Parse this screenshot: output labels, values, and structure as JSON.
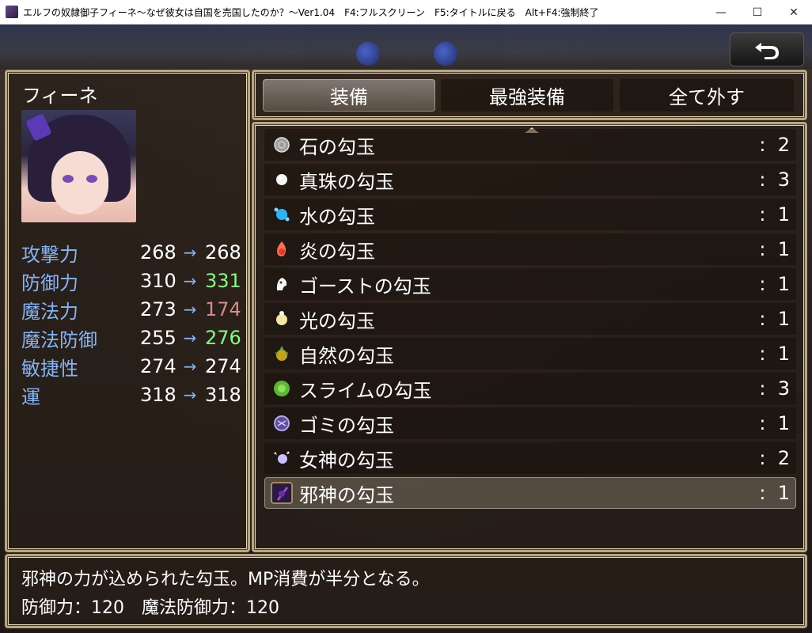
{
  "window": {
    "title": "エルフの奴隷御子フィーネ～なぜ彼女は自国を売国したのか？～Ver1.04　F4:フルスクリーン　F5:タイトルに戻る　Alt+F4:強制終了",
    "minimize": "—",
    "maximize": "☐",
    "close": "✕"
  },
  "back_button": {
    "icon": "return-arrow-icon",
    "glyph": "⮌"
  },
  "status": {
    "name": "フィーネ",
    "stats": [
      {
        "label": "攻撃力",
        "current": "268",
        "arrow": "→",
        "new": "268",
        "change": "same"
      },
      {
        "label": "防御力",
        "current": "310",
        "arrow": "→",
        "new": "331",
        "change": "up"
      },
      {
        "label": "魔法力",
        "current": "273",
        "arrow": "→",
        "new": "174",
        "change": "down"
      },
      {
        "label": "魔法防御",
        "current": "255",
        "arrow": "→",
        "new": "276",
        "change": "up"
      },
      {
        "label": "敏捷性",
        "current": "274",
        "arrow": "→",
        "new": "274",
        "change": "same"
      },
      {
        "label": "運",
        "current": "318",
        "arrow": "→",
        "new": "318",
        "change": "same"
      }
    ]
  },
  "commands": [
    {
      "label": "装備",
      "selected": true
    },
    {
      "label": "最強装備",
      "selected": false
    },
    {
      "label": "全て外す",
      "selected": false
    }
  ],
  "items": [
    {
      "name": "石の勾玉",
      "count": ":  2",
      "icon": "stone-orb-icon",
      "color": "#b9b9b9"
    },
    {
      "name": "真珠の勾玉",
      "count": ":  3",
      "icon": "pearl-icon",
      "color": "#f2f2f2"
    },
    {
      "name": "水の勾玉",
      "count": ":  1",
      "icon": "water-orb-icon",
      "color": "#4fc3f7"
    },
    {
      "name": "炎の勾玉",
      "count": ":  1",
      "icon": "fire-orb-icon",
      "color": "#f4511e"
    },
    {
      "name": "ゴーストの勾玉",
      "count": ":  1",
      "icon": "ghost-orb-icon",
      "color": "#eeeeee"
    },
    {
      "name": "光の勾玉",
      "count": ":  1",
      "icon": "light-orb-icon",
      "color": "#f3e6b0"
    },
    {
      "name": "自然の勾玉",
      "count": ":  1",
      "icon": "nature-orb-icon",
      "color": "#c6a012"
    },
    {
      "name": "スライムの勾玉",
      "count": ":  3",
      "icon": "slime-orb-icon",
      "color": "#6fcf3c"
    },
    {
      "name": "ゴミの勾玉",
      "count": ":  1",
      "icon": "trash-orb-icon",
      "color": "#8a7cc8"
    },
    {
      "name": "女神の勾玉",
      "count": ":  2",
      "icon": "goddess-orb-icon",
      "color": "#cfc6ff"
    },
    {
      "name": "邪神の勾玉",
      "count": ":  1",
      "icon": "evil-god-orb-icon",
      "color": "#a64ae0",
      "selected": true
    }
  ],
  "help": {
    "line1": "邪神の力が込められた勾玉。MP消費が半分となる。",
    "line2": "防御力：120　魔法防御力：120"
  }
}
